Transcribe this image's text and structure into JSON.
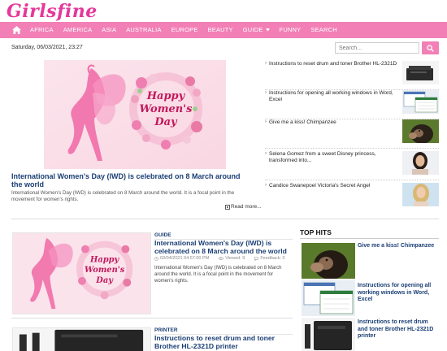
{
  "logo": {
    "text": "Girlsfine"
  },
  "colors": {
    "accent": "#f27fb6",
    "title_blue": "#1a3e74",
    "logo_pink": "#e5389a"
  },
  "nav": {
    "home_icon": "home-icon",
    "items": [
      "AFRICA",
      "AMERICA",
      "ASIA",
      "AUSTRALIA",
      "EUROPE",
      "BEAUTY",
      "GUIDE",
      "FUNNY",
      "SEARCH"
    ]
  },
  "date": "Saturday, 06/03/2021, 23:27",
  "search": {
    "placeholder": "Search...",
    "icon": "search-icon"
  },
  "featured": {
    "image_text": [
      "Happy",
      "Women's",
      "Day"
    ],
    "title": "International Women's Day (IWD) is celebrated on 8 March around the world",
    "description": "International Women's Day (IWD) is celebrated on 8 March around the world. It is a focal point in the movement for women's rights.",
    "read_more": "Read more..."
  },
  "side_list": [
    {
      "title": "Instructions to reset drum and toner Brother HL-2321D",
      "thumb": "printer"
    },
    {
      "title": "Instructions for opening all working windows in Word, Excel",
      "thumb": "windows"
    },
    {
      "title": "Give me a kiss! Chimpanzee",
      "thumb": "chimp"
    },
    {
      "title": "Selena Gomez from a sweet Disney princess, transformed into...",
      "thumb": "woman-dark"
    },
    {
      "title": "Candice Swanepoel Victoria's Secret Angel",
      "thumb": "woman-blonde"
    }
  ],
  "articles": [
    {
      "category": "GUIDE",
      "title": "International Women's Day (IWD) is celebrated on 8 March around the world",
      "date": "03/04/2021 04:57:00 PM",
      "viewed": "Viewed: 9",
      "feedback": "Feedback: 0",
      "description": "International Women's Day (IWD) is celebrated on 8 March around the world. It is a focal point in the movement for women's rights.",
      "image_text": [
        "Happy",
        "Women's",
        "Day"
      ]
    },
    {
      "category": "PRINTER",
      "title": "Instructions to reset drum and toner Brother HL-2321D printer"
    }
  ],
  "top_hits": {
    "heading": "TOP HITS",
    "items": [
      {
        "title": "Give me a kiss! Chimpanzee",
        "thumb": "chimp"
      },
      {
        "title": "Instructions for opening all working windows in Word, Excel",
        "thumb": "windows"
      },
      {
        "title": "Instructions to reset drum and toner Brother HL-2321D printer",
        "thumb": "printer"
      }
    ]
  }
}
